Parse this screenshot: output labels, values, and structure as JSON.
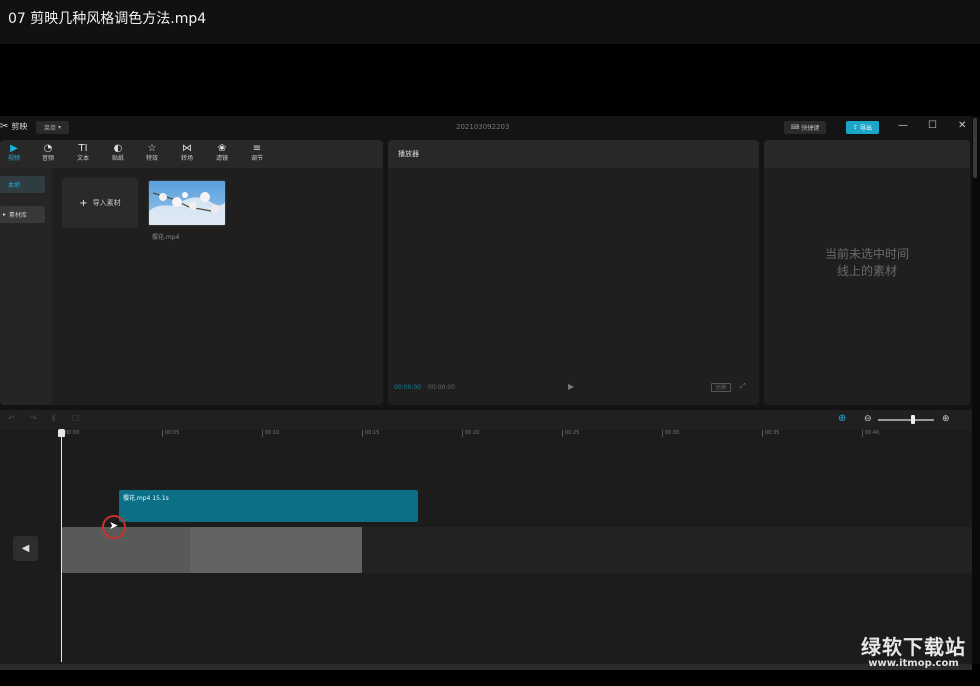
{
  "video_title": "07  剪映几种风格调色方法.mp4",
  "app": {
    "name": "剪映",
    "menu_label": "菜单",
    "project_name": "202103092203",
    "shortcut_label": "快捷键",
    "export_label": "导出",
    "window_controls": {
      "minimize": "—",
      "maximize": "☐",
      "close": "✕"
    }
  },
  "media_toolbar": [
    {
      "icon": "▶",
      "label": "视频",
      "active": true
    },
    {
      "icon": "◔",
      "label": "音频"
    },
    {
      "icon": "TI",
      "label": "文本"
    },
    {
      "icon": "◐",
      "label": "贴纸"
    },
    {
      "icon": "☆",
      "label": "特效"
    },
    {
      "icon": "⋈",
      "label": "转场"
    },
    {
      "icon": "❀",
      "label": "滤镜"
    },
    {
      "icon": "≡",
      "label": "调节"
    }
  ],
  "media_side": {
    "local": "本地",
    "library": "素材库"
  },
  "media": {
    "import_label": "导入素材",
    "file_name": "樱花.mp4"
  },
  "player": {
    "title": "播放器",
    "current_time": "00:00:00",
    "total_time": "00:00:00",
    "ratio_label": "比例"
  },
  "attributes": {
    "empty_line1": "当前未选中时间",
    "empty_line2": "线上的素材"
  },
  "timeline": {
    "ticks": [
      "00:00",
      "00:05",
      "00:10",
      "00:15",
      "00:20",
      "00:25",
      "00:30",
      "00:35",
      "00:40"
    ],
    "clip_label": "樱花.mp4   15.1s"
  },
  "watermark": {
    "cn": "绿软下载站",
    "url": "www.itmop.com"
  }
}
